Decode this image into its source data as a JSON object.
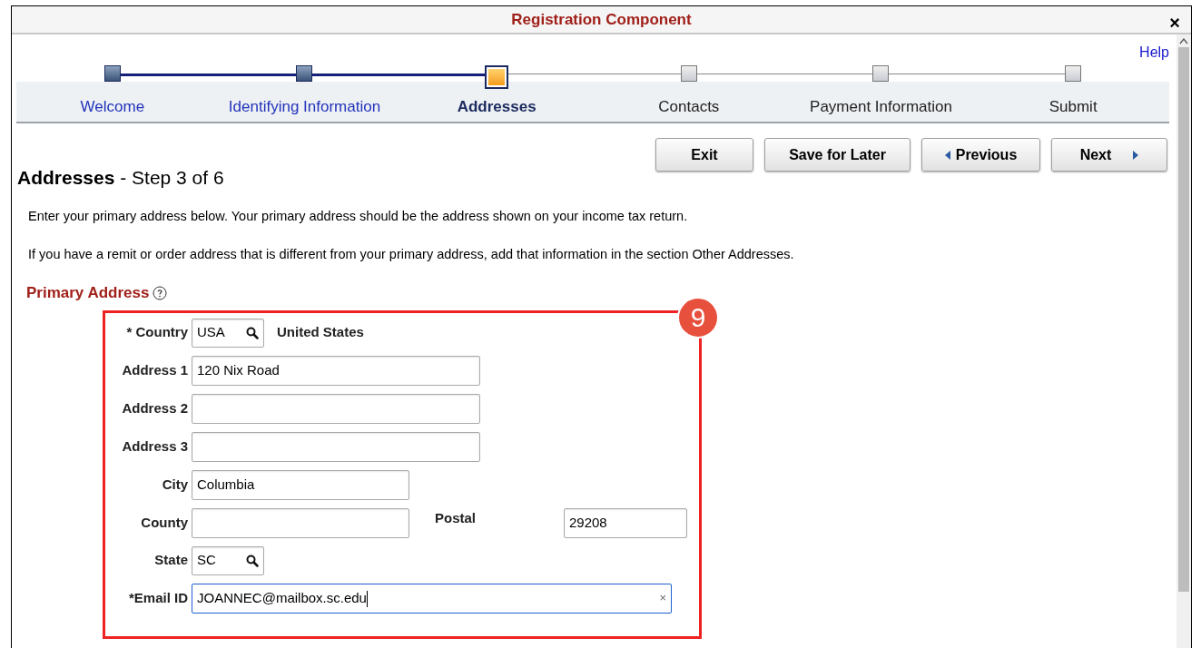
{
  "window": {
    "title": "Registration Component",
    "close": "×"
  },
  "help_link": "Help",
  "steps": [
    {
      "label": "Welcome",
      "completed": true,
      "selected": false
    },
    {
      "label": "Identifying Information",
      "completed": true,
      "selected": false
    },
    {
      "label": "Addresses",
      "completed": false,
      "selected": true
    },
    {
      "label": "Contacts",
      "completed": false,
      "selected": false
    },
    {
      "label": "Payment Information",
      "completed": false,
      "selected": false
    },
    {
      "label": "Submit",
      "completed": false,
      "selected": false
    }
  ],
  "buttons": [
    {
      "label": "Exit",
      "kind": "plain"
    },
    {
      "label": "Save for Later",
      "kind": "plain"
    },
    {
      "label": "Previous",
      "kind": "back"
    },
    {
      "label": "Next",
      "kind": "forward"
    }
  ],
  "page_title": {
    "name": "Addresses",
    "step": " - Step 3 of 6"
  },
  "instructions": [
    "Enter your primary address below. Your primary address should be the address shown on your income tax return.",
    "If you have a remit or order address that is different from your primary address, add that information in the section Other Addresses."
  ],
  "section_title": "Primary Address",
  "callout": {
    "badge": "9"
  },
  "rows": [
    {
      "fields": [
        {
          "label": "* Country",
          "kind": "lookup",
          "value": "USA",
          "description": "United States"
        }
      ]
    },
    {
      "fields": [
        {
          "label": "Address 1",
          "kind": "text",
          "value": "120 Nix Road"
        }
      ]
    },
    {
      "fields": [
        {
          "label": "Address 2",
          "kind": "text"
        }
      ]
    },
    {
      "fields": [
        {
          "label": "Address 3",
          "kind": "text"
        }
      ]
    },
    {
      "fields": [
        {
          "label": "City",
          "kind": "text",
          "value": "Columbia"
        }
      ]
    },
    {
      "fields": [
        {
          "label": "County",
          "kind": "text"
        },
        {
          "label": "Postal",
          "kind": "text",
          "value": "29208"
        }
      ]
    },
    {
      "fields": [
        {
          "label": "State",
          "kind": "lookup",
          "value": "SC"
        }
      ]
    },
    {
      "fields": [
        {
          "label": "*Email ID",
          "kind": "text",
          "value": "JOANNEC@mailbox.sc.edu",
          "focused": true,
          "clear": "×"
        }
      ]
    }
  ]
}
